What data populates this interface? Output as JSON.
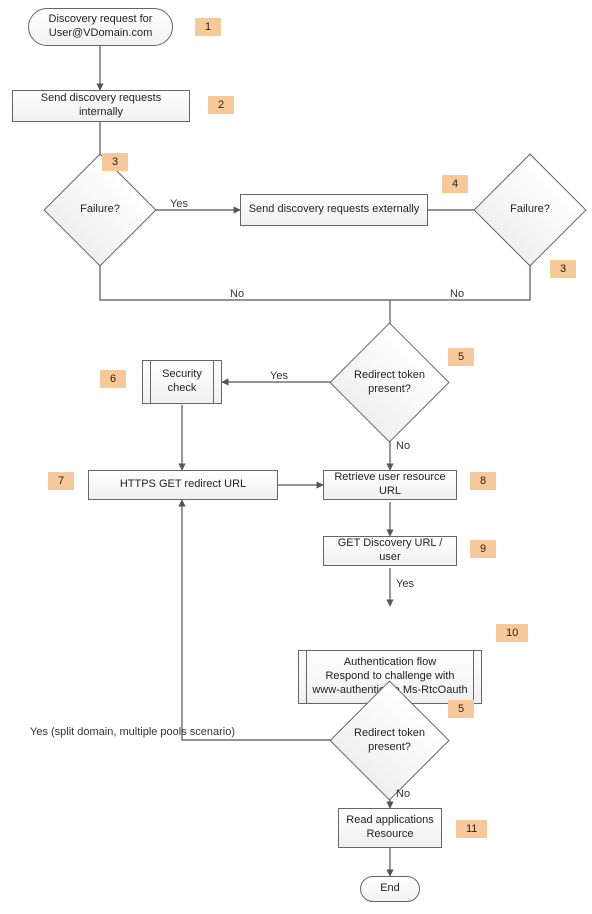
{
  "nodes": {
    "start": "Discovery request for\nUser@VDomain.com",
    "step2": "Send discovery requests internally",
    "d1": "Failure?",
    "step4": "Send discovery requests externally",
    "d2": "Failure?",
    "d5a": "Redirect token\npresent?",
    "step6": "Security\ncheck",
    "step7": "HTTPS GET redirect URL",
    "step8": "Retrieve user resource URL",
    "step9": "GET Discovery URL / user",
    "step10": "Authentication flow\nRespond to challenge with\nwww-authenticate Ms-RtcOauth",
    "d5b": "Redirect token\npresent?",
    "step11": "Read applications\nResource",
    "end": "End"
  },
  "badges": {
    "b1": "1",
    "b2": "2",
    "b3a": "3",
    "b3b": "3",
    "b4": "4",
    "b5a": "5",
    "b5b": "5",
    "b6": "6",
    "b7": "7",
    "b8": "8",
    "b9": "9",
    "b10": "10",
    "b11": "11"
  },
  "edges": {
    "yes1": "Yes",
    "noA": "No",
    "noB": "No",
    "yes5a": "Yes",
    "no5a": "No",
    "yes9": "Yes",
    "no5b": "No",
    "yesSplit": "Yes (split domain, multiple pools scenario)"
  },
  "colors": {
    "badge": "#f7c999",
    "line": "#555555"
  }
}
